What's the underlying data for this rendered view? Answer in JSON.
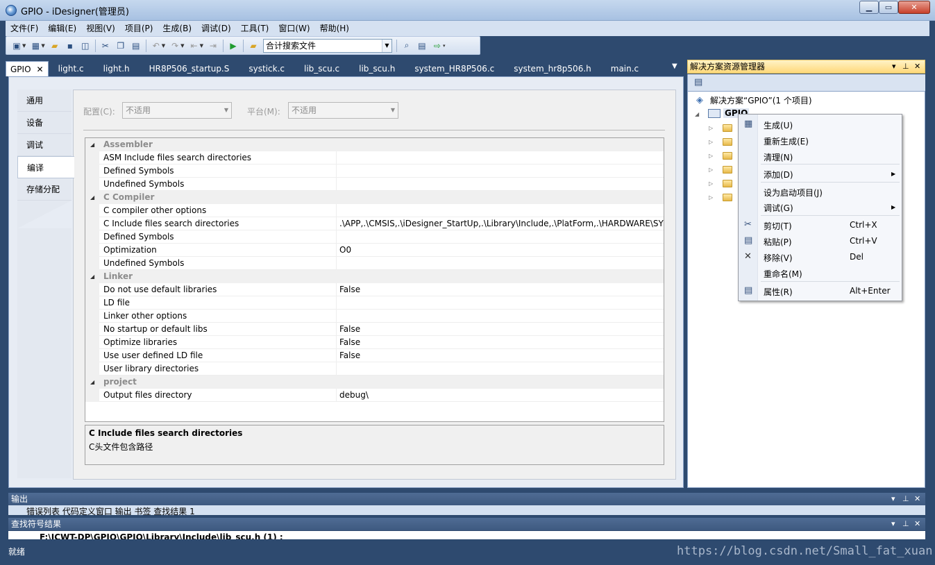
{
  "window": {
    "title": "GPIO - iDesigner(管理员)",
    "min": "▁",
    "max": "▭",
    "close": "✕"
  },
  "menu": [
    "文件(F)",
    "编辑(E)",
    "视图(V)",
    "项目(P)",
    "生成(B)",
    "调试(D)",
    "工具(T)",
    "窗口(W)",
    "帮助(H)"
  ],
  "toolbar": {
    "search_combo_value": "合计搜索文件"
  },
  "tabs": [
    "GPIO",
    "light.c",
    "light.h",
    "HR8P506_startup.S",
    "systick.c",
    "lib_scu.c",
    "lib_scu.h",
    "system_HR8P506.c",
    "system_hr8p506.h",
    "main.c"
  ],
  "tab_close": "✕",
  "leftnav": {
    "items": [
      "通用",
      "设备",
      "调试",
      "编译",
      "存储分配"
    ],
    "selected": "编译"
  },
  "config": {
    "config_label": "配置(C):",
    "config_value": "不适用",
    "platform_label": "平台(M):",
    "platform_value": "不适用"
  },
  "grid": {
    "rows": [
      {
        "type": "cat",
        "name": "Assembler"
      },
      {
        "type": "prop",
        "name": "ASM Include files search directories",
        "value": ""
      },
      {
        "type": "prop",
        "name": "Defined Symbols",
        "value": ""
      },
      {
        "type": "prop",
        "name": "Undefined Symbols",
        "value": ""
      },
      {
        "type": "cat",
        "name": "C Compiler"
      },
      {
        "type": "prop",
        "name": "C compiler other options",
        "value": ""
      },
      {
        "type": "prop",
        "name": "C Include files search directories",
        "value": ".\\APP,.\\CMSIS,.\\iDesigner_StartUp,.\\Library\\Include,.\\PlatForm,.\\HARDWARE\\SYST"
      },
      {
        "type": "prop",
        "name": "Defined Symbols",
        "value": ""
      },
      {
        "type": "prop",
        "name": "Optimization",
        "value": "O0"
      },
      {
        "type": "prop",
        "name": "Undefined Symbols",
        "value": ""
      },
      {
        "type": "cat",
        "name": "Linker"
      },
      {
        "type": "prop",
        "name": "Do not use default libraries",
        "value": "False"
      },
      {
        "type": "prop",
        "name": "LD file",
        "value": ""
      },
      {
        "type": "prop",
        "name": "Linker other options",
        "value": ""
      },
      {
        "type": "prop",
        "name": "No startup or default libs",
        "value": "False"
      },
      {
        "type": "prop",
        "name": "Optimize libraries",
        "value": "False"
      },
      {
        "type": "prop",
        "name": "Use user defined LD file",
        "value": "False"
      },
      {
        "type": "prop",
        "name": "User library directories",
        "value": ""
      },
      {
        "type": "cat",
        "name": "project"
      },
      {
        "type": "prop",
        "name": "Output files directory",
        "value": "debug\\"
      }
    ]
  },
  "description": {
    "title": "C Include files search directories",
    "text": "C头文件包含路径"
  },
  "solution": {
    "title": "解决方案资源管理器",
    "root": "解决方案“GPIO”(1 个项目)",
    "project": "GPIO"
  },
  "context_menu": [
    {
      "label": "生成(U)",
      "key": "",
      "sub": false,
      "icon": "build-icon"
    },
    {
      "label": "重新生成(E)",
      "key": "",
      "sub": false,
      "icon": ""
    },
    {
      "label": "清理(N)",
      "key": "",
      "sub": false,
      "icon": ""
    },
    {
      "label": "添加(D)",
      "key": "",
      "sub": true,
      "icon": ""
    },
    {
      "label": "设为启动项目(J)",
      "key": "",
      "sub": false,
      "icon": ""
    },
    {
      "label": "调试(G)",
      "key": "",
      "sub": true,
      "icon": ""
    },
    {
      "label": "剪切(T)",
      "key": "Ctrl+X",
      "sub": false,
      "icon": "scissors-icon"
    },
    {
      "label": "粘贴(P)",
      "key": "Ctrl+V",
      "sub": false,
      "icon": "paste-icon"
    },
    {
      "label": "移除(V)",
      "key": "Del",
      "sub": false,
      "icon": "delete-icon"
    },
    {
      "label": "重命名(M)",
      "key": "",
      "sub": false,
      "icon": ""
    },
    {
      "label": "属性(R)",
      "key": "Alt+Enter",
      "sub": false,
      "icon": "properties-icon"
    }
  ],
  "output_pane": {
    "title": "输出",
    "tabs_partial": "错误列表 代码定义窗口 输出 书签 查找结果 1"
  },
  "find_pane": {
    "title": "查找符号结果",
    "line_partial": "F:\\JCWT-DP\\GPIO\\GPIO\\Library\\Include\\lib_scu.h (1) :"
  },
  "status": {
    "text": "就绪"
  },
  "watermark": "https://blog.csdn.net/Small_fat_xuan"
}
